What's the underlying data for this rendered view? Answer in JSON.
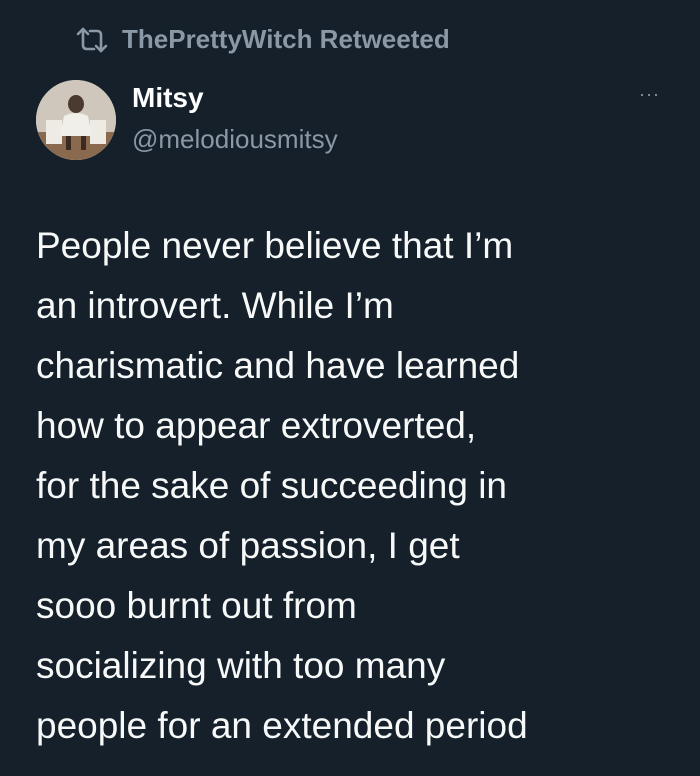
{
  "retweet": {
    "icon": "retweet-icon",
    "text": "ThePrettyWitch Retweeted"
  },
  "author": {
    "avatar": "avatar",
    "display_name": "Mitsy",
    "handle": "@melodiousmitsy"
  },
  "menu": {
    "icon": "more-icon",
    "label": "···"
  },
  "tweet": {
    "lines": [
      "People never believe that I’m",
      "an introvert. While I’m",
      "charismatic and have learned",
      "how to appear extroverted,",
      "for the sake of succeeding in",
      "my areas of passion, I get",
      "sooo burnt out from",
      "socializing with too many",
      "people for an extended period"
    ]
  },
  "colors": {
    "background": "#15202b",
    "text": "#f7f9f9",
    "secondary": "#8b98a5"
  }
}
